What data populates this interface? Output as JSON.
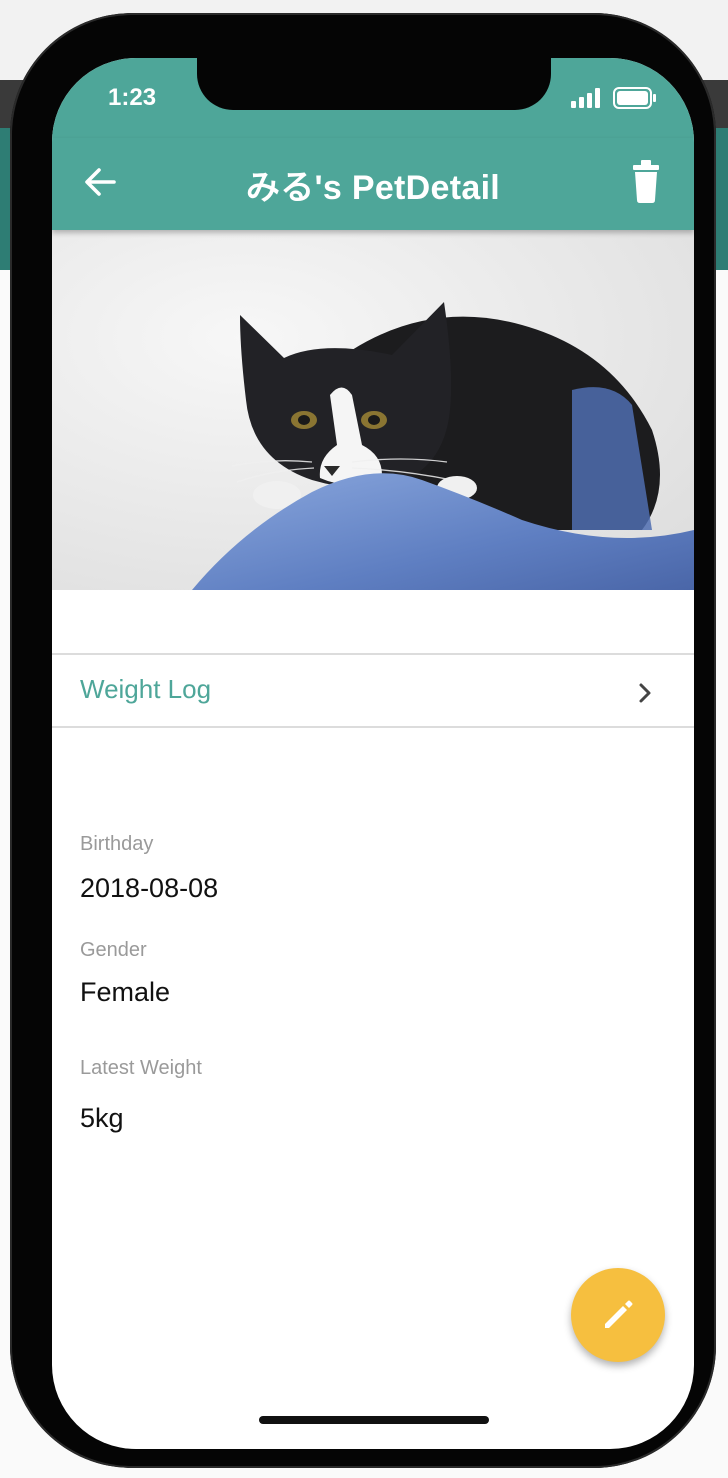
{
  "status_bar": {
    "time": "1:23"
  },
  "app_bar": {
    "title": "みる's PetDetail"
  },
  "weight_log": {
    "label": "Weight Log"
  },
  "details": {
    "birthday_label": "Birthday",
    "birthday_value": "2018-08-08",
    "gender_label": "Gender",
    "gender_value": "Female",
    "weight_label": "Latest Weight",
    "weight_value": "5kg"
  },
  "colors": {
    "primary": "#4ea699",
    "accent": "#f6bf3f"
  },
  "icons": {
    "back": "arrow-back-icon",
    "delete": "trash-icon",
    "chevron": "chevron-right-icon",
    "edit": "pencil-icon"
  }
}
